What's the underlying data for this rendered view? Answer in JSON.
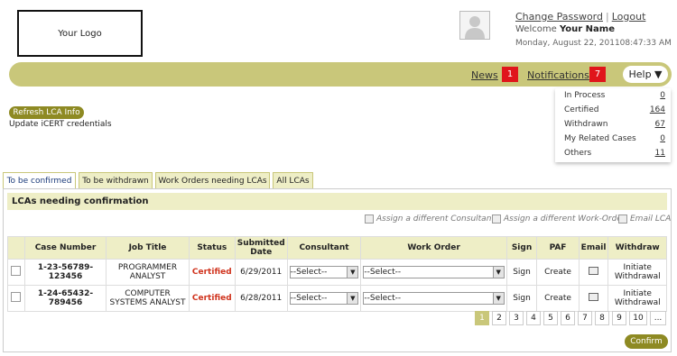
{
  "header": {
    "logo_text": "Your Logo",
    "change_password": "Change Password",
    "separator": "|",
    "logout": "Logout",
    "welcome_label": "Welcome",
    "user_name": "Your Name",
    "datetime": "Monday, August 22, 201108:47:33 AM"
  },
  "nav": {
    "news_label": "News",
    "news_count": "1",
    "notifications_label": "Notifications",
    "notifications_count": "7",
    "help_label": "Help ▼"
  },
  "stats": [
    {
      "label": "In Process",
      "value": "0"
    },
    {
      "label": "Certified",
      "value": "164"
    },
    {
      "label": "Withdrawn",
      "value": "67"
    },
    {
      "label": "My Related Cases",
      "value": "0"
    },
    {
      "label": "Others",
      "value": "11"
    }
  ],
  "refresh": {
    "button": "Refresh LCA Info",
    "note": "Update iCERT credentials"
  },
  "tabs": [
    "To be confirmed",
    "To be withdrawn",
    "Work Orders needing LCAs",
    "All LCAs"
  ],
  "section_title": "LCAs needing confirmation",
  "actions": [
    "Assign a different Consultant",
    "Assign a different Work-Order",
    "Email LCA"
  ],
  "table": {
    "headers": [
      "",
      "Case Number",
      "Job Title",
      "Status",
      "Submitted Date",
      "Consultant",
      "Work Order",
      "Sign",
      "PAF",
      "Email",
      "Withdraw"
    ],
    "rows": [
      {
        "case": "1-23-56789-123456",
        "job": "PROGRAMMER ANALYST",
        "status": "Certified",
        "date": "6/29/2011",
        "consultant": "--Select--",
        "workorder": "--Select--",
        "sign": "Sign",
        "paf": "Create",
        "withdraw": "Initiate Withdrawal"
      },
      {
        "case": "1-24-65432-789456",
        "job": "COMPUTER SYSTEMS ANALYST",
        "status": "Certified",
        "date": "6/28/2011",
        "consultant": "--Select--",
        "workorder": "--Select--",
        "sign": "Sign",
        "paf": "Create",
        "withdraw": "Initiate Withdrawal"
      }
    ]
  },
  "pagination": [
    "1",
    "2",
    "3",
    "4",
    "5",
    "6",
    "7",
    "8",
    "9",
    "10",
    "..."
  ],
  "confirm_label": "Confirm",
  "colors": {
    "accent": "#c9c77a",
    "button": "#8e8a23",
    "badge": "#e0151b",
    "certified": "#d0341e"
  }
}
